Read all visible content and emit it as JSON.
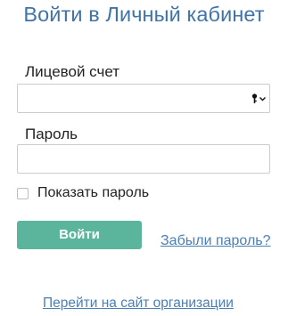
{
  "header": {
    "title": "Войти в Личный кабинет"
  },
  "form": {
    "account_label": "Лицевой счет",
    "account_value": "",
    "password_label": "Пароль",
    "password_value": "",
    "show_password_label": "Показать пароль",
    "show_password_checked": false,
    "login_button": "Войти",
    "forgot_password_link": "Забыли пароль?"
  },
  "footer": {
    "org_site_link": "Перейти на сайт организации"
  },
  "colors": {
    "title": "#3f74a9",
    "button": "#5ab59c",
    "link": "#4a7fb5"
  },
  "icons": {
    "autofill": "key-icon"
  }
}
